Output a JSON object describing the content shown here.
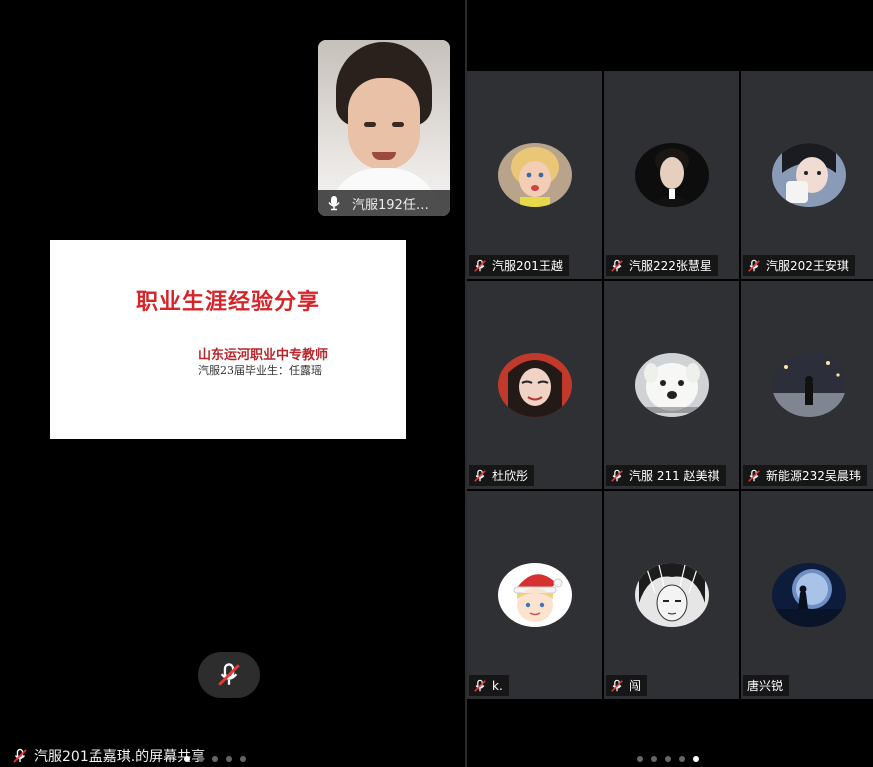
{
  "self_view": {
    "name": "汽服192任…"
  },
  "slide": {
    "title": "职业生涯经验分享",
    "subtitle": "山东运河职业中专教师",
    "graduate": "汽服23届毕业生：任露瑶"
  },
  "screen_share": {
    "label": "汽服201孟嘉琪.的屏幕共享"
  },
  "pager_left": {
    "count": 5,
    "active": 0
  },
  "pager_right": {
    "count": 5,
    "active": 4
  },
  "participants": [
    {
      "name": "汽服201王越",
      "muted": true,
      "avatar": "child-photo"
    },
    {
      "name": "汽服222张慧星",
      "muted": true,
      "avatar": "man-portrait"
    },
    {
      "name": "汽服202王安琪",
      "muted": true,
      "avatar": "woman-cup"
    },
    {
      "name": "杜欣彤",
      "muted": true,
      "avatar": "girl-red-scarf"
    },
    {
      "name": "汽服 211 赵美祺",
      "muted": true,
      "avatar": "white-dog"
    },
    {
      "name": "新能源232吴晨玮",
      "muted": true,
      "avatar": "night-street"
    },
    {
      "name": "k.",
      "muted": true,
      "avatar": "anime-santa-hat"
    },
    {
      "name": "闯",
      "muted": true,
      "avatar": "manga-portrait"
    },
    {
      "name": "唐兴锐",
      "muted": false,
      "avatar": "moon-silhouette"
    }
  ],
  "colors": {
    "tile_bg": "#2f3033",
    "slide_title": "#d5252a",
    "mute_red": "#e53935"
  },
  "icons": {
    "muted_mic": "muted-mic-icon",
    "mic": "mic-icon"
  }
}
